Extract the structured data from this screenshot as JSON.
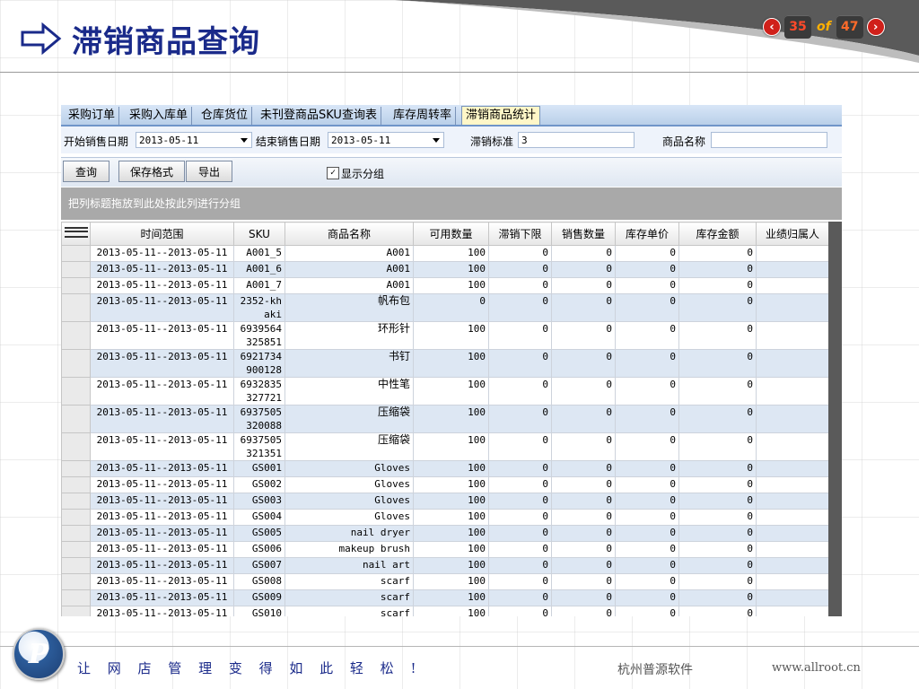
{
  "slide": {
    "title": "滞销商品查询",
    "page_current": "35",
    "page_of": "of",
    "page_total": "47",
    "prev_icon": "‹",
    "next_icon": "›",
    "slogan": "让 网 店 管 理 变 得 如 此 轻 松 !",
    "company": "杭州普源软件",
    "website": "www.allroot.cn",
    "logo_letter": "P"
  },
  "app": {
    "tabs": [
      "采购订单",
      "采购入库单",
      "仓库货位",
      "未刊登商品SKU查询表",
      "库存周转率",
      "滞销商品统计"
    ],
    "active_tab": "滞销商品统计",
    "filters": {
      "start_label": "开始销售日期",
      "start_value": "2013-05-11",
      "end_label": "结束销售日期",
      "end_value": "2013-05-11",
      "standard_label": "滞销标准",
      "standard_value": "3",
      "name_label": "商品名称",
      "name_value": ""
    },
    "toolbar": {
      "query": "查询",
      "save_format": "保存格式",
      "export": "导出",
      "show_group_label": "显示分组",
      "show_group_checked": "✓"
    },
    "group_hint": "把列标题拖放到此处按此列进行分组",
    "columns": [
      "时间范围",
      "SKU",
      "商品名称",
      "可用数量",
      "滞销下限",
      "销售数量",
      "库存单价",
      "库存金额",
      "业绩归属人"
    ],
    "rows": [
      {
        "range": "2013-05-11--2013-05-11",
        "sku": "A001_5",
        "name": "A001",
        "avail": "100",
        "low": "0",
        "sold": "0",
        "price": "0",
        "amount": "0",
        "owner": ""
      },
      {
        "range": "2013-05-11--2013-05-11",
        "sku": "A001_6",
        "name": "A001",
        "avail": "100",
        "low": "0",
        "sold": "0",
        "price": "0",
        "amount": "0",
        "owner": ""
      },
      {
        "range": "2013-05-11--2013-05-11",
        "sku": "A001_7",
        "name": "A001",
        "avail": "100",
        "low": "0",
        "sold": "0",
        "price": "0",
        "amount": "0",
        "owner": ""
      },
      {
        "range": "2013-05-11--2013-05-11",
        "sku": "2352-khaki",
        "name": "帆布包",
        "avail": "0",
        "low": "0",
        "sold": "0",
        "price": "0",
        "amount": "0",
        "owner": ""
      },
      {
        "range": "2013-05-11--2013-05-11",
        "sku": "6939564325851",
        "name": "环形针",
        "avail": "100",
        "low": "0",
        "sold": "0",
        "price": "0",
        "amount": "0",
        "owner": ""
      },
      {
        "range": "2013-05-11--2013-05-11",
        "sku": "6921734900128",
        "name": "书钉",
        "avail": "100",
        "low": "0",
        "sold": "0",
        "price": "0",
        "amount": "0",
        "owner": ""
      },
      {
        "range": "2013-05-11--2013-05-11",
        "sku": "6932835327721",
        "name": "中性笔",
        "avail": "100",
        "low": "0",
        "sold": "0",
        "price": "0",
        "amount": "0",
        "owner": ""
      },
      {
        "range": "2013-05-11--2013-05-11",
        "sku": "6937505320088",
        "name": "压缩袋",
        "avail": "100",
        "low": "0",
        "sold": "0",
        "price": "0",
        "amount": "0",
        "owner": ""
      },
      {
        "range": "2013-05-11--2013-05-11",
        "sku": "6937505321351",
        "name": "压缩袋",
        "avail": "100",
        "low": "0",
        "sold": "0",
        "price": "0",
        "amount": "0",
        "owner": ""
      },
      {
        "range": "2013-05-11--2013-05-11",
        "sku": "GS001",
        "name": "Gloves",
        "avail": "100",
        "low": "0",
        "sold": "0",
        "price": "0",
        "amount": "0",
        "owner": ""
      },
      {
        "range": "2013-05-11--2013-05-11",
        "sku": "GS002",
        "name": "Gloves",
        "avail": "100",
        "low": "0",
        "sold": "0",
        "price": "0",
        "amount": "0",
        "owner": ""
      },
      {
        "range": "2013-05-11--2013-05-11",
        "sku": "GS003",
        "name": "Gloves",
        "avail": "100",
        "low": "0",
        "sold": "0",
        "price": "0",
        "amount": "0",
        "owner": ""
      },
      {
        "range": "2013-05-11--2013-05-11",
        "sku": "GS004",
        "name": "Gloves",
        "avail": "100",
        "low": "0",
        "sold": "0",
        "price": "0",
        "amount": "0",
        "owner": ""
      },
      {
        "range": "2013-05-11--2013-05-11",
        "sku": "GS005",
        "name": "nail dryer",
        "avail": "100",
        "low": "0",
        "sold": "0",
        "price": "0",
        "amount": "0",
        "owner": ""
      },
      {
        "range": "2013-05-11--2013-05-11",
        "sku": "GS006",
        "name": "makeup brush",
        "avail": "100",
        "low": "0",
        "sold": "0",
        "price": "0",
        "amount": "0",
        "owner": ""
      },
      {
        "range": "2013-05-11--2013-05-11",
        "sku": "GS007",
        "name": "nail art",
        "avail": "100",
        "low": "0",
        "sold": "0",
        "price": "0",
        "amount": "0",
        "owner": ""
      },
      {
        "range": "2013-05-11--2013-05-11",
        "sku": "GS008",
        "name": "scarf",
        "avail": "100",
        "low": "0",
        "sold": "0",
        "price": "0",
        "amount": "0",
        "owner": ""
      },
      {
        "range": "2013-05-11--2013-05-11",
        "sku": "GS009",
        "name": "scarf",
        "avail": "100",
        "low": "0",
        "sold": "0",
        "price": "0",
        "amount": "0",
        "owner": ""
      },
      {
        "range": "2013-05-11--2013-05-11",
        "sku": "GS010",
        "name": "scarf",
        "avail": "100",
        "low": "0",
        "sold": "0",
        "price": "0",
        "amount": "0",
        "owner": ""
      }
    ]
  }
}
